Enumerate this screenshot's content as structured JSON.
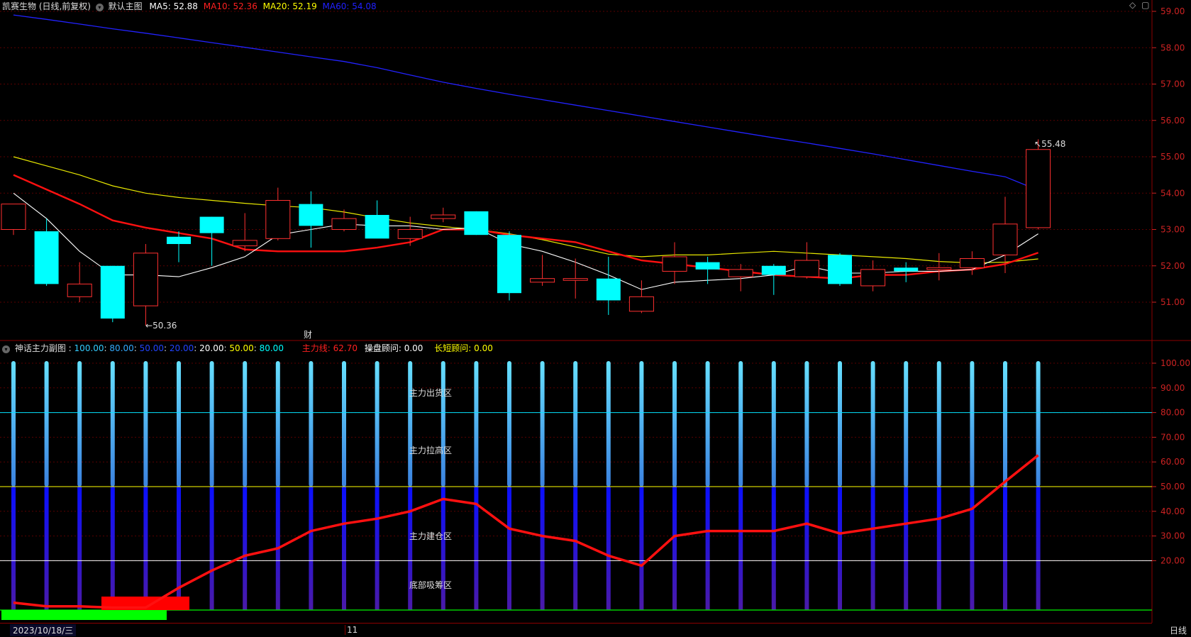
{
  "header": {
    "stock": "凯赛生物 (日线,前复权)",
    "main_chart_label": "默认主图",
    "ma": [
      {
        "label": "MA5:",
        "value": "52.88",
        "color": "#ffffff"
      },
      {
        "label": "MA10:",
        "value": "52.36",
        "color": "#ff2020"
      },
      {
        "label": "MA20:",
        "value": "52.19",
        "color": "#ffff00"
      },
      {
        "label": "MA60:",
        "value": "54.08",
        "color": "#2020ff"
      }
    ]
  },
  "sub_header": {
    "name": "神话主力副图",
    "levels": [
      {
        "text": "100.00",
        "color": "#33ccff"
      },
      {
        "text": "80.00",
        "color": "#33aaff"
      },
      {
        "text": "50.00",
        "color": "#2244ff"
      },
      {
        "text": "20.00",
        "color": "#ffffff"
      },
      {
        "text": "50.00",
        "color": "#ffff00"
      },
      {
        "text": "80.00",
        "color": "#00ffff"
      }
    ],
    "main_force_label": "主力线:",
    "main_force_value": "62.70",
    "trader_label": "操盘顾问:",
    "trader_value": "0.00",
    "long_short_label": "长短顾问:",
    "long_short_value": "0.00"
  },
  "zones": {
    "distribution": "主力出货区",
    "pull_up": "主力拉高区",
    "accumulate": "主力建仓区",
    "bottom": "底部吸筹区"
  },
  "annotations": {
    "low": "50.36",
    "high": "55.48",
    "caibao": "财"
  },
  "footer": {
    "date": "2023/10/18/三",
    "month_mark": "11",
    "period": "日线"
  },
  "price_axis": [
    "59.00",
    "58.00",
    "57.00",
    "56.00",
    "55.00",
    "54.00",
    "53.00",
    "52.00",
    "51.00"
  ],
  "sub_axis": [
    "100.00",
    "90.00",
    "80.00",
    "70.00",
    "60.00",
    "50.00",
    "40.00",
    "30.00",
    "20.00"
  ],
  "chart_data": {
    "type": "candlestick",
    "y_range": [
      50.0,
      59.3
    ],
    "candles": [
      {
        "o": 53.0,
        "h": 53.7,
        "l": 52.85,
        "c": 53.7
      },
      {
        "o": 52.95,
        "h": 53.3,
        "l": 51.45,
        "c": 51.5
      },
      {
        "o": 51.15,
        "h": 52.1,
        "l": 51.0,
        "c": 51.5
      },
      {
        "o": 52.0,
        "h": 52.0,
        "l": 50.45,
        "c": 50.55
      },
      {
        "o": 50.9,
        "h": 52.6,
        "l": 50.36,
        "c": 52.35
      },
      {
        "o": 52.8,
        "h": 52.95,
        "l": 52.1,
        "c": 52.6
      },
      {
        "o": 53.35,
        "h": 53.35,
        "l": 52.0,
        "c": 52.9
      },
      {
        "o": 52.55,
        "h": 53.45,
        "l": 52.4,
        "c": 52.7
      },
      {
        "o": 52.75,
        "h": 54.15,
        "l": 52.7,
        "c": 53.8
      },
      {
        "o": 53.7,
        "h": 54.05,
        "l": 52.5,
        "c": 53.1
      },
      {
        "o": 53.0,
        "h": 53.55,
        "l": 52.95,
        "c": 53.3
      },
      {
        "o": 53.4,
        "h": 53.8,
        "l": 52.8,
        "c": 52.75
      },
      {
        "o": 52.75,
        "h": 53.35,
        "l": 52.55,
        "c": 53.0
      },
      {
        "o": 53.3,
        "h": 53.6,
        "l": 53.2,
        "c": 53.4
      },
      {
        "o": 53.5,
        "h": 53.5,
        "l": 52.85,
        "c": 52.85
      },
      {
        "o": 52.85,
        "h": 52.95,
        "l": 51.05,
        "c": 51.25
      },
      {
        "o": 51.55,
        "h": 52.3,
        "l": 51.45,
        "c": 51.65
      },
      {
        "o": 51.6,
        "h": 52.2,
        "l": 51.1,
        "c": 51.65
      },
      {
        "o": 51.65,
        "h": 52.25,
        "l": 50.65,
        "c": 51.05
      },
      {
        "o": 50.75,
        "h": 51.6,
        "l": 50.7,
        "c": 51.15
      },
      {
        "o": 51.85,
        "h": 52.65,
        "l": 51.5,
        "c": 52.25
      },
      {
        "o": 52.1,
        "h": 52.25,
        "l": 51.5,
        "c": 51.9
      },
      {
        "o": 51.7,
        "h": 52.05,
        "l": 51.3,
        "c": 51.9
      },
      {
        "o": 52.0,
        "h": 52.05,
        "l": 51.2,
        "c": 51.75
      },
      {
        "o": 51.7,
        "h": 52.65,
        "l": 51.65,
        "c": 52.15
      },
      {
        "o": 52.3,
        "h": 52.35,
        "l": 51.45,
        "c": 51.5
      },
      {
        "o": 51.45,
        "h": 52.15,
        "l": 51.3,
        "c": 51.9
      },
      {
        "o": 51.95,
        "h": 52.1,
        "l": 51.55,
        "c": 51.85
      },
      {
        "o": 51.9,
        "h": 52.35,
        "l": 51.6,
        "c": 51.95
      },
      {
        "o": 51.95,
        "h": 52.4,
        "l": 51.75,
        "c": 52.2
      },
      {
        "o": 52.3,
        "h": 53.9,
        "l": 51.8,
        "c": 53.15
      },
      {
        "o": 53.05,
        "h": 55.48,
        "l": 53.0,
        "c": 55.2
      }
    ],
    "ma5": [
      54.0,
      53.3,
      52.4,
      51.75,
      51.75,
      51.7,
      51.95,
      52.25,
      52.85,
      53.0,
      53.15,
      53.1,
      53.1,
      53.0,
      53.05,
      52.6,
      52.4,
      52.1,
      51.75,
      51.35,
      51.55,
      51.6,
      51.65,
      51.75,
      52.0,
      51.8,
      51.8,
      51.85,
      51.85,
      51.9,
      52.3,
      52.88
    ],
    "ma10": [
      54.5,
      54.1,
      53.7,
      53.25,
      53.05,
      52.9,
      52.75,
      52.45,
      52.4,
      52.4,
      52.4,
      52.5,
      52.65,
      53.0,
      53.0,
      52.85,
      52.75,
      52.65,
      52.4,
      52.15,
      52.05,
      51.95,
      51.85,
      51.75,
      51.7,
      51.65,
      51.75,
      51.75,
      51.85,
      51.9,
      52.05,
      52.36
    ],
    "ma20": [
      55.0,
      54.75,
      54.5,
      54.2,
      54.0,
      53.88,
      53.8,
      53.72,
      53.65,
      53.6,
      53.48,
      53.32,
      53.18,
      53.08,
      53.0,
      52.88,
      52.72,
      52.52,
      52.32,
      52.25,
      52.3,
      52.3,
      52.35,
      52.4,
      52.35,
      52.3,
      52.25,
      52.2,
      52.12,
      52.08,
      52.1,
      52.19
    ],
    "ma60": [
      58.9,
      58.78,
      58.65,
      58.52,
      58.4,
      58.27,
      58.14,
      58.01,
      57.88,
      57.75,
      57.62,
      57.45,
      57.25,
      57.05,
      56.88,
      56.72,
      56.57,
      56.42,
      56.27,
      56.12,
      55.97,
      55.82,
      55.67,
      55.52,
      55.38,
      55.23,
      55.08,
      54.92,
      54.76,
      54.6,
      54.45,
      54.08
    ],
    "main_force": [
      3,
      1.5,
      1.5,
      1,
      1,
      9,
      16,
      22,
      25,
      32,
      35,
      37,
      40,
      45,
      43,
      33,
      30,
      28,
      22,
      18,
      30,
      32,
      32,
      32,
      35,
      31,
      33,
      35,
      37,
      41,
      52,
      62.7
    ],
    "sub_y_range": [
      0,
      100
    ]
  }
}
